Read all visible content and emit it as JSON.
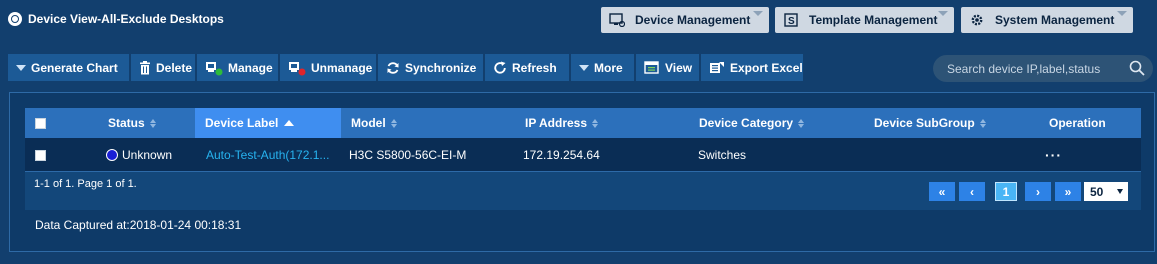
{
  "page_title": "Device View-All-Exclude Desktops",
  "top_tabs": [
    {
      "label": "Device Management",
      "icon": "monitor-icon"
    },
    {
      "label": "Template Management",
      "icon": "template-icon"
    },
    {
      "label": "System Management",
      "icon": "gear-icon"
    }
  ],
  "toolbar": {
    "generate_chart": "Generate Chart",
    "delete": "Delete",
    "manage": "Manage",
    "unmanage": "Unmanage",
    "synchronize": "Synchronize",
    "refresh": "Refresh",
    "more": "More",
    "view": "View",
    "export_excel": "Export Excel"
  },
  "search": {
    "placeholder": "Search device IP,label,status"
  },
  "table": {
    "columns": [
      "Status",
      "Device Label",
      "Model",
      "IP Address",
      "Device Category",
      "Device SubGroup",
      "Operation"
    ],
    "sorted_column": "Device Label",
    "rows": [
      {
        "status": "Unknown",
        "device_label": "Auto-Test-Auth(172.1...",
        "model": "H3C S5800-56C-EI-M",
        "ip": "172.19.254.64",
        "category": "Switches",
        "subgroup": "",
        "operation": "···"
      }
    ]
  },
  "pager": {
    "info": "1-1 of 1. Page 1 of 1.",
    "first": "«",
    "prev": "‹",
    "current_page": "1",
    "next": "›",
    "last": "»",
    "page_size": "50"
  },
  "captured": "Data Captured at:2018-01-24 00:18:31",
  "colors": {
    "background": "#123f6e",
    "header": "#2c70bb",
    "sorted_header": "#3f8ef0",
    "link": "#27b3f0",
    "status_unknown": "#1a1fd6"
  }
}
